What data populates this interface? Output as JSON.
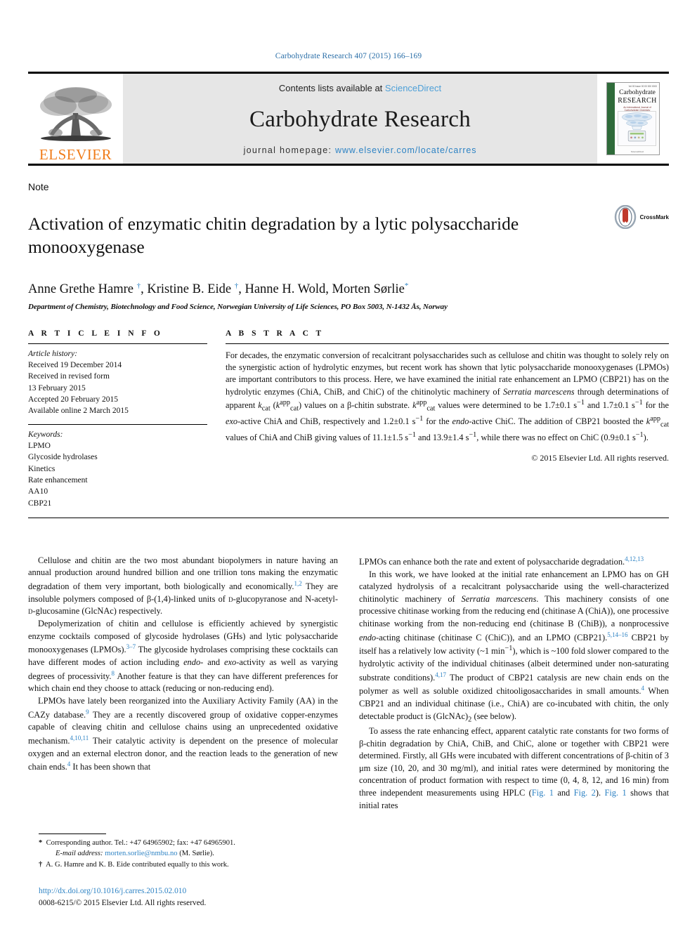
{
  "running_head": "Carbohydrate Research 407 (2015) 166–169",
  "masthead": {
    "publisher_name": "ELSEVIER",
    "contents_prefix": "Contents lists available at ",
    "contents_link": "ScienceDirect",
    "journal_title": "Carbohydrate Research",
    "homepage_prefix": "journal homepage: ",
    "homepage_url": "www.elsevier.com/locate/carres",
    "cover": {
      "header_small": "Vol 00 Issue 00 00 000 0000",
      "line1": "Carbohydrate",
      "line2": "RESEARCH",
      "subtitle": "An International Journal of Carbohydrate Chemistry",
      "footer": "ScienceDirect"
    }
  },
  "article": {
    "type_label": "Note",
    "title": "Activation of enzymatic chitin degradation by a lytic polysaccharide monooxygenase",
    "crossmark_label": "CrossMark",
    "authors_html": "Anne Grethe Hamre <sup>†</sup>, Kristine B. Eide <sup>†</sup>, Hanne H. Wold, Morten Sørlie<sup>*</sup>",
    "affiliation": "Department of Chemistry, Biotechnology and Food Science, Norwegian University of Life Sciences, PO Box 5003, N-1432 Ås, Norway"
  },
  "article_info": {
    "heading": "A R T I C L E   I N F O",
    "history_label": "Article history:",
    "history": [
      "Received 19 December 2014",
      "Received in revised form",
      "13 February 2015",
      "Accepted 20 February 2015",
      "Available online 2 March 2015"
    ],
    "keywords_label": "Keywords:",
    "keywords": [
      "LPMO",
      "Glycoside hydrolases",
      "Kinetics",
      "Rate enhancement",
      "AA10",
      "CBP21"
    ]
  },
  "abstract": {
    "heading": "A B S T R A C T",
    "body_html": "For decades, the enzymatic conversion of recalcitrant polysaccharides such as cellulose and chitin was thought to solely rely on the synergistic action of hydrolytic enzymes, but recent work has shown that lytic polysaccharide monooxygenases (LPMOs) are important contributors to this process. Here, we have examined the initial rate enhancement an LPMO (CBP21) has on the hydrolytic enzymes (ChiA, ChiB, and ChiC) of the chitinolytic machinery of <i>Serratia marcescens</i> through determinations of apparent <i>k</i><sub>cat</sub> (<i>k</i><sup>app</sup><sub>cat</sub>) values on a β-chitin substrate. <i>k</i><sup>app</sup><sub>cat</sub> values were determined to be 1.7±0.1 s<sup>−1</sup> and 1.7±0.1 s<sup>−1</sup> for the <i>exo</i>-active ChiA and ChiB, respectively and 1.2±0.1 s<sup>−1</sup> for the <i>endo</i>-active ChiC. The addition of CBP21 boosted the <i>k</i><sup>app</sup><sub>cat</sub> values of ChiA and ChiB giving values of 11.1±1.5 s<sup>−1</sup> and 13.9±1.4 s<sup>−1</sup>, while there was no effect on ChiC (0.9±0.1 s<sup>−1</sup>).",
    "copyright": "© 2015 Elsevier Ltd. All rights reserved."
  },
  "body": {
    "left_paragraphs_html": [
      "Cellulose and chitin are the two most abundant biopolymers in nature having an annual production around hundred billion and one trillion tons making the enzymatic degradation of them very important, both biologically and economically.<sup class=\"ref\">1,2</sup> They are insoluble polymers composed of β-(1,4)-linked units of <span style=\"font-variant:small-caps\">d</span>-glucopyranose and N-acetyl-<span style=\"font-variant:small-caps\">d</span>-glucosamine (GlcNAc) respectively.",
      "Depolymerization of chitin and cellulose is efficiently achieved by synergistic enzyme cocktails composed of glycoside hydrolases (GHs) and lytic polysaccharide monooxygenases (LPMOs).<sup class=\"ref\">3–7</sup> The glycoside hydrolases comprising these cocktails can have different modes of action including <i>endo</i>- and <i>exo</i>-activity as well as varying degrees of processivity.<sup class=\"ref\">8</sup> Another feature is that they can have different preferences for which chain end they choose to attack (reducing or non-reducing end).",
      "LPMOs have lately been reorganized into the Auxiliary Activity Family (AA) in the CAZy database.<sup class=\"ref\">9</sup> They are a recently discovered group of oxidative copper-enzymes capable of cleaving chitin and cellulose chains using an unprecedented oxidative mechanism.<sup class=\"ref\">4,10,11</sup> Their catalytic activity is dependent on the presence of molecular oxygen and an external electron donor, and the reaction leads to the generation of new chain ends.<sup class=\"ref\">4</sup> It has been shown that"
    ],
    "right_paragraphs_html": [
      "LPMOs can enhance both the rate and extent of polysaccharide degradation.<sup class=\"ref\">4,12,13</sup>",
      "In this work, we have looked at the initial rate enhancement an LPMO has on GH catalyzed hydrolysis of a recalcitrant polysaccharide using the well-characterized chitinolytic machinery of <i>Serratia marcescens</i>. This machinery consists of one processive chitinase working from the reducing end (chitinase A (ChiA)), one processive chitinase working from the non-reducing end (chitinase B (ChiB)), a nonprocessive <i>endo</i>-acting chitinase (chitinase C (ChiC)), and an LPMO (CBP21).<sup class=\"ref\">5,14–16</sup> CBP21 by itself has a relatively low activity (~1 min<sup>−1</sup>), which is ~100 fold slower compared to the hydrolytic activity of the individual chitinases (albeit determined under non-saturating substrate conditions).<sup class=\"ref\">4,17</sup> The product of CBP21 catalysis are new chain ends on the polymer as well as soluble oxidized chitooligosaccharides in small amounts.<sup class=\"ref\">4</sup> When CBP21 and an individual chitinase (i.e., ChiA) are co-incubated with chitin, the only detectable product is (GlcNAc)<sub>2</sub> (see below).",
      "To assess the rate enhancing effect, apparent catalytic rate constants for two forms of β-chitin degradation by ChiA, ChiB, and ChiC, alone or together with CBP21 were determined. Firstly, all GHs were incubated with different concentrations of β-chitin of 3 μm size (10, 20, and 30 mg/ml), and initial rates were determined by monitoring the concentration of product formation with respect to time (0, 4, 8, 12, and 16 min) from three independent measurements using HPLC (<span class=\"lnk\">Fig. 1</span> and <span class=\"lnk\">Fig. 2</span>). <span class=\"lnk\">Fig. 1</span> shows that initial rates"
    ]
  },
  "footnotes": {
    "corresponding_html": "<b>*</b>&nbsp; Corresponding author. Tel.: +47 64965902; fax: +47 64965901.",
    "email_html": "<i>E-mail address:</i> <span class=\"lnk\">morten.sorlie@nmbu.no</span> (M. Sørlie).",
    "equal_contrib_html": "<b>†</b>&nbsp; A. G. Hamre and K. B. Eide contributed equally to this work."
  },
  "doc_footer": {
    "doi": "http://dx.doi.org/10.1016/j.carres.2015.02.010",
    "issn_line": "0008-6215/© 2015 Elsevier Ltd. All rights reserved."
  },
  "colors": {
    "link_blue": "#2e83c4",
    "elsevier_orange": "#f07c1a",
    "masthead_grey": "#e6e6e6",
    "crossmark_red": "#c0392b"
  }
}
